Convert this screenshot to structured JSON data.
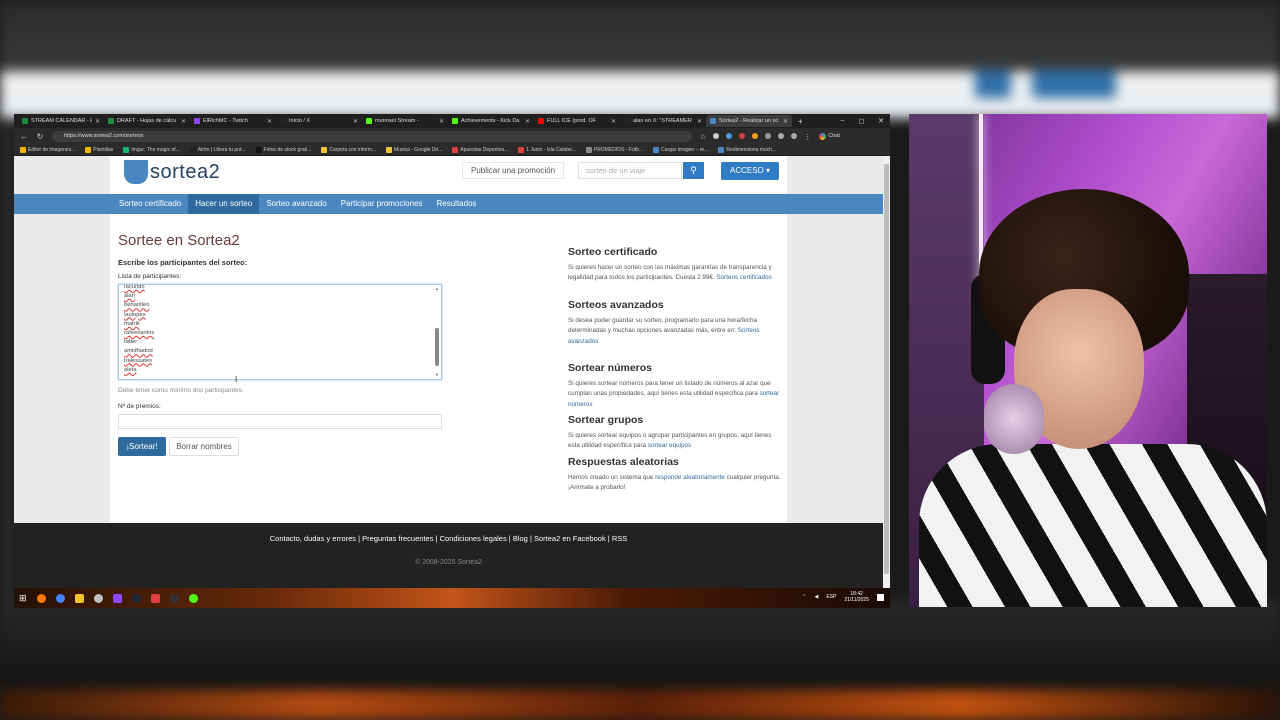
{
  "browser": {
    "tabs": [
      {
        "label": "STREAM CALENDAR - H",
        "color": "#1e8e3e"
      },
      {
        "label": "DRAFT - Hojas de cálcu",
        "color": "#1e8e3e"
      },
      {
        "label": "ElRichMC - Twitch",
        "color": "#9146ff"
      },
      {
        "label": "Inicio / X",
        "color": "#222222"
      },
      {
        "label": "munnset Stream -",
        "color": "#53fc18"
      },
      {
        "label": "Achievements - Kick Da",
        "color": "#53fc18"
      },
      {
        "label": "FULL ICE (prod. OF",
        "color": "#ff0000"
      },
      {
        "label": "alan en X: \"STREAMER",
        "color": "#222222"
      },
      {
        "label": "Sortea2 - Realizar un so",
        "color": "#4a87c0"
      }
    ],
    "new_tab": "+",
    "window_controls": {
      "minimize": "–",
      "maximize": "◻",
      "close": "✕"
    },
    "url": "https://www.sortea2.com/sorteos",
    "chat_label": "Chat",
    "bookmarks": [
      "Editor de imagenes...",
      "Plantillas",
      "Imgur: The magic of...",
      "Airtm | Libera tu pot...",
      "Fotos de stock grati...",
      "Carpeta con inform...",
      "Musica - Google Dri...",
      "Apuestas Deportiva...",
      "1 Junio - Isla Calabe...",
      "PROMEDIOS - Fútb...",
      "Cargar imagen – re...",
      "Redimensiona much..."
    ]
  },
  "site": {
    "logo_text": "sortea2",
    "promo_button": "Publicar una promoción",
    "search_placeholder": "sorteo de un viaje",
    "search_icon": "search-icon",
    "acceso_button": "ACCESO ▾",
    "menu": [
      {
        "label": "Sorteo certificado",
        "active": false
      },
      {
        "label": "Hacer un sorteo",
        "active": true
      },
      {
        "label": "Sorteo avanzado",
        "active": false
      },
      {
        "label": "Participar promociones",
        "active": false
      },
      {
        "label": "Resultados",
        "active": false
      }
    ]
  },
  "form": {
    "title": "Sortee en Sortea2",
    "subtitle": "Escribe los participantes del sorteo:",
    "participants_label": "Lista de participantes:",
    "participants": [
      "facundo",
      "alan",
      "benantleo",
      "laulopes",
      "matrik",
      "rafeesantos",
      "tatter",
      "amidhadod",
      "tralessates",
      "aleta"
    ],
    "hint": "Debe tener como mínimo dos participantes.",
    "prizes_label": "Nº de premios:",
    "prizes_value": "",
    "submit_button": "¡Sortear!",
    "clear_button": "Borrar nombres"
  },
  "sidebar": {
    "sections": [
      {
        "title": "Sorteo certificado",
        "text": "Si quieres hacer un sorteo con las máximas garantías de transparencia y legalidad para todos los participantes. Cuesta 2.99€.",
        "link": "Sorteos certificados"
      },
      {
        "title": "Sorteos avanzados",
        "text": "Si desea poder guardar su sorteo, programarlo para una hora/fecha determinadas y muchas opciones avanzadas más, entre en:",
        "link": "Sorteos avanzados"
      },
      {
        "title": "Sortear números",
        "text": "Si quieres sortear números para tener un listado de números al azar que cumplan unas propiedades, aquí tienes esta utilidad específica para",
        "link": "sortear números"
      },
      {
        "title": "Sortear grupos",
        "text": "Si quieres sortear equipos o agrupar participantes en grupos, aquí tienes esta utilidad específica para",
        "link": "sortear equipos"
      },
      {
        "title": "Respuestas aleatorias",
        "text": "Hemos creado un sistema que",
        "link": "responde aleatoriamente",
        "text_after": "cualquier pregunta. ¡Anímate a probarlo!"
      }
    ]
  },
  "footer": {
    "links": [
      "Contacto, dudas y errores",
      "Preguntas frecuentes",
      "Condiciones legales",
      "Blog",
      "Sortea2 en Facebook",
      "RSS"
    ],
    "copyright": "© 2008-2025 Sortea2"
  },
  "taskbar": {
    "lang": "ESP",
    "time": "18:42",
    "date": "21/11/2025"
  }
}
